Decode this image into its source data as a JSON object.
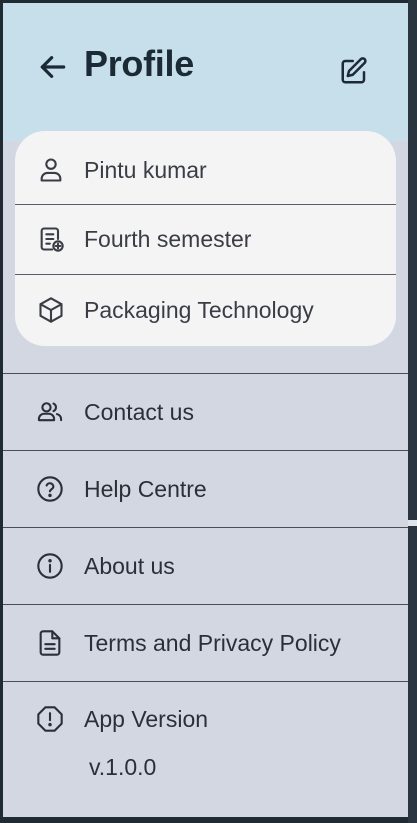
{
  "header": {
    "title": "Profile",
    "back_icon": "arrow-left-icon",
    "edit_icon": "edit-icon",
    "background": "#c6dfea"
  },
  "profile_card": {
    "items": [
      {
        "label": "Pintu kumar",
        "icon": "person-icon"
      },
      {
        "label": "Fourth semester",
        "icon": "document-add-icon"
      },
      {
        "label": "Packaging Technology",
        "icon": "cube-icon"
      }
    ]
  },
  "menu": {
    "items": [
      {
        "label": "Contact us",
        "icon": "people-icon"
      },
      {
        "label": "Help Centre",
        "icon": "help-circle-icon"
      },
      {
        "label": "About us",
        "icon": "info-circle-icon"
      },
      {
        "label": "Terms and Privacy Policy",
        "icon": "document-icon"
      },
      {
        "label": "App Version",
        "icon": "alert-circle-icon"
      }
    ],
    "app_version_value": "v.1.0.0"
  },
  "colors": {
    "page_background": "#d3d7e1",
    "card_background": "#f4f4f4",
    "title_color": "#1c2a36"
  }
}
